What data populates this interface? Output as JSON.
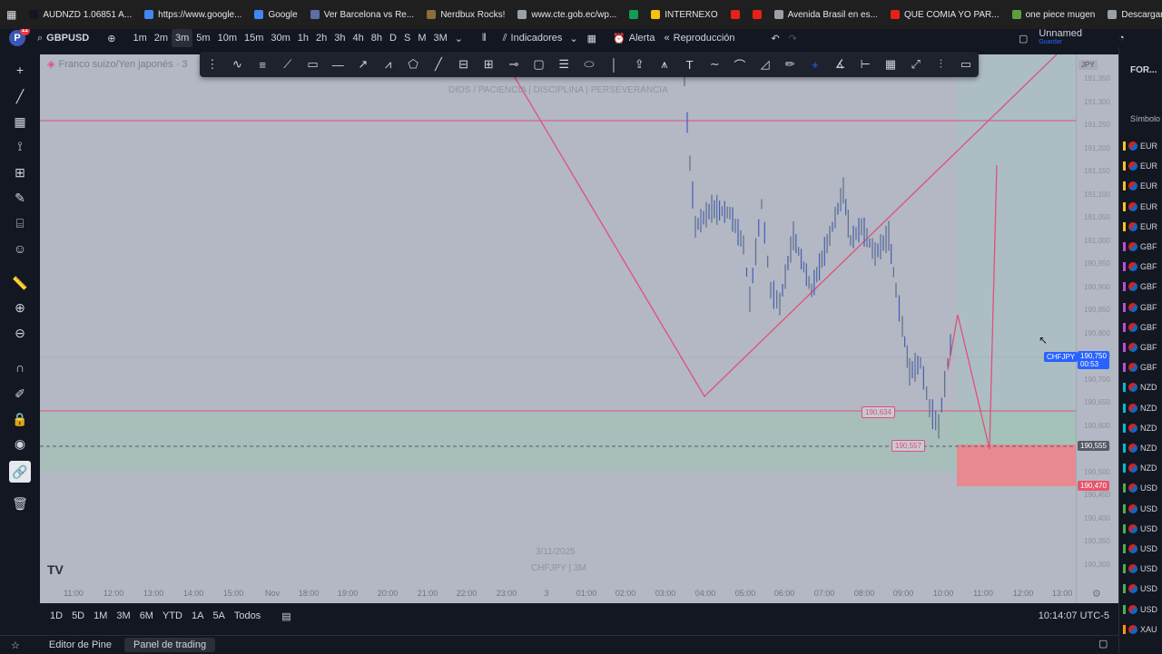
{
  "bookmarks": [
    {
      "label": "AUDNZD 1.06851 A...",
      "color": "#131722"
    },
    {
      "label": "https://www.google...",
      "color": "#4285f4"
    },
    {
      "label": "Google",
      "color": "#4285f4"
    },
    {
      "label": "Ver Barcelona vs Re...",
      "color": "#5b6fa5"
    },
    {
      "label": "Nerdbux Rocks!",
      "color": "#8a6d3b"
    },
    {
      "label": "www.cte.gob.ec/wp...",
      "color": "#9aa0a6"
    },
    {
      "label": "",
      "color": "#0f9d58"
    },
    {
      "label": "INTERNEXO",
      "color": "#f4c20d"
    },
    {
      "label": "",
      "color": "#e62117"
    },
    {
      "label": "",
      "color": "#e62117"
    },
    {
      "label": "Avenida Brasil en es...",
      "color": "#9aa0a6"
    },
    {
      "label": "QUE COMIA YO PAR...",
      "color": "#e62117"
    },
    {
      "label": "one piece mugen",
      "color": "#5f9e3f"
    },
    {
      "label": "Descargar Musica d...",
      "color": "#9aa0a6"
    }
  ],
  "header": {
    "avatar_letter": "P",
    "badge": "11",
    "symbol": "GBPUSD",
    "timeframes": [
      "1m",
      "2m",
      "3m",
      "5m",
      "10m",
      "15m",
      "30m",
      "1h",
      "2h",
      "3h",
      "4h",
      "8h",
      "D",
      "S",
      "M",
      "3M"
    ],
    "selected_timeframe": "3m",
    "indicators": "Indicadores",
    "alert": "Alerta",
    "replay": "Reproducción",
    "layout_name": "Unnamed",
    "save_label": "Guardar"
  },
  "legend": {
    "title": "Franco suizo/Yen japonés · 3"
  },
  "watermark": {
    "top": "DIOS / PACIENCIA  |  DISCIPLINA  |  PERSEVERANCIA",
    "date": "3/11/2025",
    "symbol": "CHFJPY  |  3M"
  },
  "price_axis": {
    "currency": "JPY",
    "labels": [
      "191,350",
      "191,300",
      "191,250",
      "191,200",
      "191,150",
      "191,100",
      "191,050",
      "191,000",
      "190,950",
      "190,900",
      "190,850",
      "190,800",
      "190,750",
      "190,700",
      "190,650",
      "190,600",
      "190,550",
      "190,500",
      "190,450",
      "190,400",
      "190,350",
      "190,300"
    ],
    "current_price": "190,750",
    "countdown": "00:53",
    "symbol_tag": "CHFJPY",
    "line_price": "190,555",
    "stop_price": "190,470"
  },
  "chart_labels": {
    "lvl1": "190,634",
    "lvl2": "190,557"
  },
  "time_axis": [
    "11:00",
    "12:00",
    "13:00",
    "14:00",
    "15:00",
    "Nov",
    "18:00",
    "19:00",
    "20:00",
    "21:00",
    "22:00",
    "23:00",
    "3",
    "01:00",
    "02:00",
    "03:00",
    "04:00",
    "05:00",
    "06:00",
    "07:00",
    "08:00",
    "09:00",
    "10:00",
    "11:00",
    "12:00",
    "13:00"
  ],
  "ranges": [
    "1D",
    "5D",
    "1M",
    "3M",
    "6M",
    "YTD",
    "1A",
    "5A",
    "Todos"
  ],
  "clock": "10:14:07 UTC-5",
  "panels": [
    "Editor de Pine",
    "Panel de trading"
  ],
  "watchlist": {
    "title": "FOR...",
    "section": "Símbolo",
    "items": [
      "EUR",
      "EUR",
      "EUR",
      "EUR",
      "EUR",
      "GBF",
      "GBF",
      "GBF",
      "GBF",
      "GBF",
      "GBF",
      "GBF",
      "NZD",
      "NZD",
      "NZD",
      "NZD",
      "NZD",
      "USD",
      "USD",
      "USD",
      "USD",
      "USD",
      "USD",
      "USD",
      "XAU"
    ],
    "colors": {
      "EUR": "#f7c325",
      "GBF": "#b84fd6",
      "NZD": "#00bcd4",
      "USD": "#4caf50",
      "XAU": "#ff9800"
    }
  },
  "colors": {
    "accent": "#2962ff",
    "drawing": "#e0507a",
    "zone_green": "#9fc2b2",
    "zone_red": "#e8898f"
  }
}
